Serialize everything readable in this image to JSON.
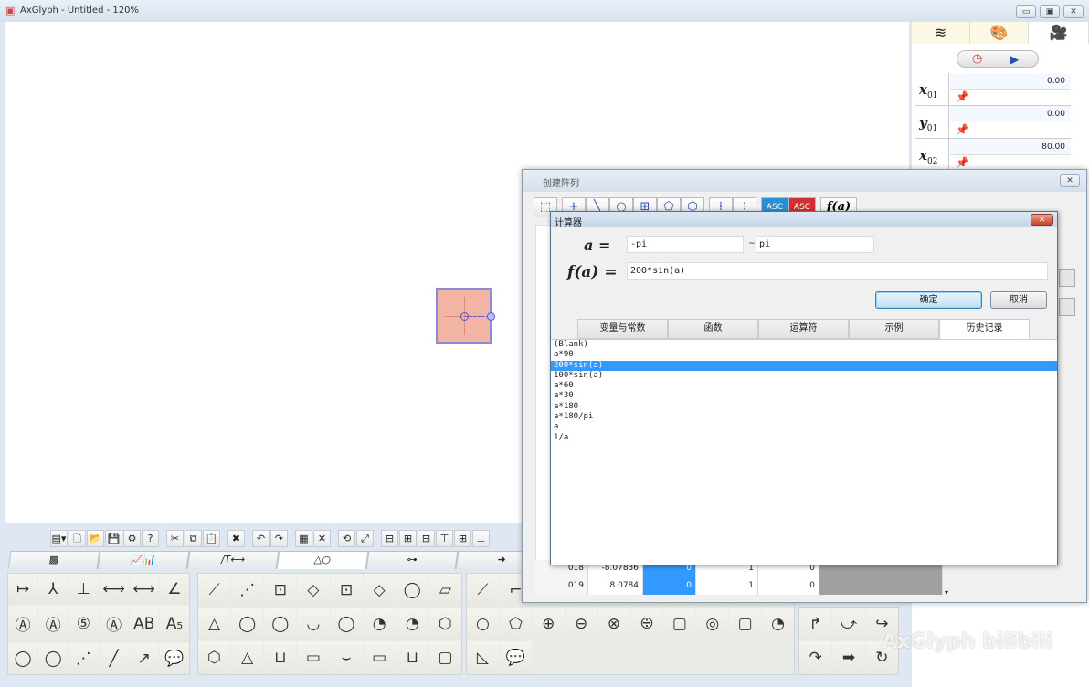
{
  "window": {
    "title": "AxGlyph - Untitled - 120%",
    "minimize": "▭",
    "restore": "▣",
    "close": "✕"
  },
  "right_panel": {
    "tabs": [
      {
        "icon": "layers-icon",
        "glyph": "≋"
      },
      {
        "icon": "palette-icon",
        "glyph": "🎨"
      },
      {
        "icon": "camera-icon",
        "glyph": "🎥"
      }
    ],
    "timer_icon": "◷",
    "play_icon": "▶",
    "properties": [
      {
        "label": "x",
        "sub": "01",
        "value": "0.00"
      },
      {
        "label": "y",
        "sub": "01",
        "value": "0.00"
      },
      {
        "label": "x",
        "sub": "02",
        "value": "80.00"
      }
    ]
  },
  "toolbar": {
    "buttons": [
      "▤▾",
      "🗋",
      "📂",
      "💾",
      "⚙",
      "?",
      "✂",
      "⧉",
      "📋",
      "✖",
      "↶",
      "↷",
      "▦",
      "✕",
      "⟲",
      "⤢",
      "⊟",
      "⊞",
      "⊟",
      "⊤",
      "⊞",
      "⊥"
    ]
  },
  "palette_tabs": [
    {
      "label": "▩"
    },
    {
      "label": "📈📊"
    },
    {
      "label": "/T⟷"
    },
    {
      "label": "△○"
    },
    {
      "label": "⊶"
    },
    {
      "label": "➜"
    }
  ],
  "palette": {
    "g1": [
      "↦",
      "⅄",
      "⊥",
      "⟷",
      "⟷",
      "∠",
      "Ⓐ",
      "Ⓐ",
      "⑤",
      "Ⓐ",
      "AB",
      "A₅",
      "◯",
      "◯",
      "⋰",
      "╱",
      "↗",
      "💬"
    ],
    "g2": [
      "⟋",
      "⋰",
      "⊡",
      "◇",
      "⊡",
      "◇",
      "◯",
      "▱",
      "△",
      "◯",
      "◯",
      "◡",
      "◯",
      "◔",
      "◔",
      "⬡",
      "⬡",
      "△",
      "⊔",
      "▭",
      "⌣",
      "▭",
      "⊔",
      "▢"
    ],
    "g3": [
      "⟋",
      "⌐",
      "▭",
      "▱",
      "⌷",
      "⌷",
      "▢",
      "⏢",
      "▭",
      "⬡",
      "○",
      "⬠",
      "⊕",
      "⊖",
      "⊗",
      "⨸",
      "▢",
      "◎",
      "▢",
      "◔",
      "◺",
      "💬"
    ],
    "g4": [
      "↱",
      "⤻",
      "↪",
      "↷",
      "➡",
      "↻"
    ]
  },
  "array_dialog": {
    "title": "创建阵列",
    "close": "✕",
    "tools": [
      "⬚",
      "+",
      "╲",
      "○",
      "⊞",
      "⬠",
      "⬡",
      "⁞",
      "⁝",
      "ASC",
      "ASC",
      "f(a)"
    ],
    "rows": [
      {
        "idx": "018",
        "x": "-8.07836",
        "y": "0",
        "a": "1",
        "b": "0"
      },
      {
        "idx": "019",
        "x": "8.0784",
        "y": "0",
        "a": "1",
        "b": "0"
      }
    ]
  },
  "calculator": {
    "title": "计算器",
    "close": "✕",
    "var_label": "a =",
    "from": "-pi",
    "tilde": "~",
    "to": "pi",
    "func_label": "f(a) =",
    "expression": "200*sin(a)",
    "ok": "确定",
    "cancel": "取消",
    "tabs": [
      "变量与常数",
      "函数",
      "运算符",
      "示例",
      "历史记录"
    ],
    "active_tab": "历史记录",
    "history": [
      "(Blank)",
      "a*90",
      "200*sin(a)",
      "100*sin(a)",
      "a*60",
      "a*30",
      "a*180",
      "a*180/pi",
      "a",
      "1/a"
    ],
    "selected": "200*sin(a)"
  },
  "watermark": "AxGlyph bilibili"
}
